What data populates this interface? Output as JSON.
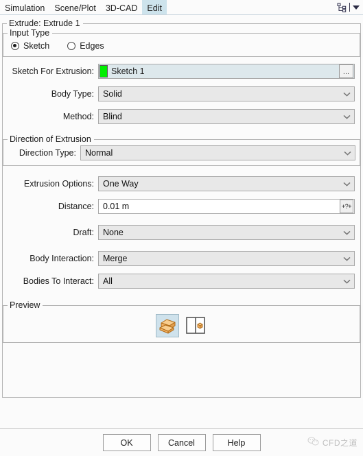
{
  "window": {
    "tabs": [
      {
        "label": "Simulation",
        "active": false
      },
      {
        "label": "Scene/Plot",
        "active": false
      },
      {
        "label": "3D-CAD",
        "active": false
      },
      {
        "label": "Edit",
        "active": true
      }
    ],
    "tree_icon": "tree-hierarchy-icon",
    "dropdown_icon": "caret-down-icon"
  },
  "panel": {
    "title": "Extrude: Extrude 1"
  },
  "input_type": {
    "legend": "Input Type",
    "options": [
      {
        "label": "Sketch",
        "selected": true
      },
      {
        "label": "Edges",
        "selected": false
      }
    ]
  },
  "sketch_for_extrusion": {
    "label": "Sketch For Extrusion:",
    "value": "Sketch 1",
    "swatch_color": "#00ee00",
    "browse_label": "...",
    "field_bg": "#dde8ec"
  },
  "body_type": {
    "label": "Body Type:",
    "value": "Solid"
  },
  "method": {
    "label": "Method:",
    "value": "Blind"
  },
  "direction_of_extrusion": {
    "legend": "Direction of Extrusion",
    "direction_type": {
      "label": "Direction Type:",
      "value": "Normal"
    }
  },
  "extrusion_options": {
    "label": "Extrusion Options:",
    "value": "One Way"
  },
  "distance": {
    "label": "Distance:",
    "value": "0.01 m",
    "unit_button_label": "+?+"
  },
  "draft": {
    "label": "Draft:",
    "value": "None"
  },
  "body_interaction": {
    "label": "Body Interaction:",
    "value": "Merge"
  },
  "bodies_to_interact": {
    "label": "Bodies To Interact:",
    "value": "All"
  },
  "preview": {
    "legend": "Preview",
    "buttons": [
      {
        "name": "shaded-solid-preview-icon",
        "selected": true
      },
      {
        "name": "split-view-preview-icon",
        "selected": false
      }
    ]
  },
  "footer": {
    "buttons": [
      {
        "label": "OK",
        "name": "ok-button"
      },
      {
        "label": "Cancel",
        "name": "cancel-button"
      },
      {
        "label": "Help",
        "name": "help-button"
      }
    ],
    "watermark": {
      "text": "CFD之道",
      "icon": "wechat-logo-icon"
    }
  },
  "colors": {
    "tab_active_bg": "#cde3ec",
    "combo_bg": "#e8e8e8",
    "border": "#a9a9a9",
    "selector_bg": "#dde8ec",
    "preview_sel_bg": "#cfe2ec",
    "orange": "#f5b460"
  }
}
